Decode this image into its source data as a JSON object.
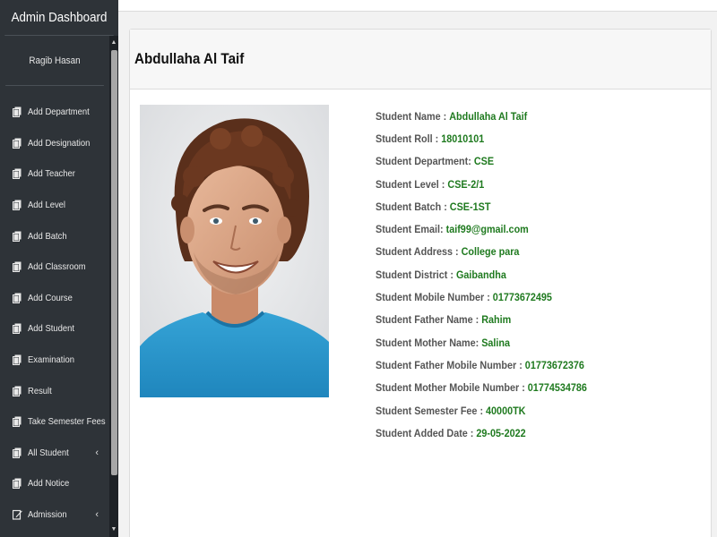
{
  "app": {
    "title": "Admin Dashboard",
    "user_name": "Ragib Hasan"
  },
  "sidebar": {
    "items": [
      {
        "label": "Add Department",
        "icon": "copy-icon",
        "has_children": false
      },
      {
        "label": "Add Designation",
        "icon": "copy-icon",
        "has_children": false
      },
      {
        "label": "Add Teacher",
        "icon": "copy-icon",
        "has_children": false
      },
      {
        "label": "Add Level",
        "icon": "copy-icon",
        "has_children": false
      },
      {
        "label": "Add Batch",
        "icon": "copy-icon",
        "has_children": false
      },
      {
        "label": "Add Classroom",
        "icon": "copy-icon",
        "has_children": false
      },
      {
        "label": "Add Course",
        "icon": "copy-icon",
        "has_children": false
      },
      {
        "label": "Add Student",
        "icon": "copy-icon",
        "has_children": false
      },
      {
        "label": "Examination",
        "icon": "copy-icon",
        "has_children": false
      },
      {
        "label": "Result",
        "icon": "copy-icon",
        "has_children": false
      },
      {
        "label": "Take Semester Fees",
        "icon": "copy-icon",
        "has_children": false
      },
      {
        "label": "All Student",
        "icon": "copy-icon",
        "has_children": true
      },
      {
        "label": "Add Notice",
        "icon": "copy-icon",
        "has_children": false
      },
      {
        "label": "Admission",
        "icon": "edit-icon",
        "has_children": true
      }
    ],
    "chevron": "‹"
  },
  "profile": {
    "name": "Abdullaha Al Taif",
    "fields": [
      {
        "label": "Student Name : ",
        "value": "Abdullaha Al Taif"
      },
      {
        "label": "Student Roll : ",
        "value": "18010101"
      },
      {
        "label": "Student Department: ",
        "value": "CSE"
      },
      {
        "label": "Student Level : ",
        "value": "CSE-2/1"
      },
      {
        "label": "Student Batch : ",
        "value": "CSE-1ST"
      },
      {
        "label": "Student Email: ",
        "value": "taif99@gmail.com"
      },
      {
        "label": "Student Address : ",
        "value": "College para"
      },
      {
        "label": "Student District : ",
        "value": "Gaibandha"
      },
      {
        "label": "Student Mobile Number : ",
        "value": "01773672495"
      },
      {
        "label": "Student Father Name : ",
        "value": "Rahim"
      },
      {
        "label": "Student Mother Name: ",
        "value": "Salina"
      },
      {
        "label": "Student Father Mobile Number : ",
        "value": "01773672376"
      },
      {
        "label": "Student Mother Mobile Number : ",
        "value": "01774534786"
      },
      {
        "label": "Student Semester Fee : ",
        "value": "40000TK"
      },
      {
        "label": "Student Added Date : ",
        "value": "29-05-2022"
      }
    ]
  },
  "colors": {
    "sidebar_bg": "#2e3338",
    "value_green": "#1f7a1f",
    "label_gray": "#555555"
  }
}
